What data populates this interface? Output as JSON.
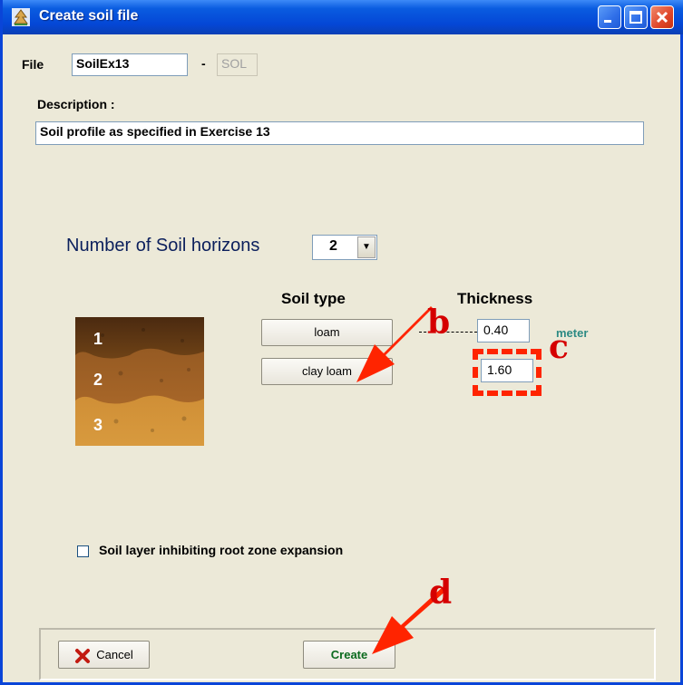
{
  "window": {
    "title": "Create soil file",
    "app_icon": "aquacrop-app-icon"
  },
  "file": {
    "label": "File",
    "name_value": "SoilEx13",
    "separator": "-",
    "extension": "SOL"
  },
  "description": {
    "label": "Description :",
    "value": "Soil profile as specified in Exercise 13"
  },
  "horizons": {
    "label": "Number of Soil horizons",
    "selected": "2"
  },
  "columns": {
    "soil_type": "Soil type",
    "thickness": "Thickness"
  },
  "layers": [
    {
      "soil_type": "loam",
      "thickness": "0.40"
    },
    {
      "soil_type": "clay loam",
      "thickness": "1.60"
    }
  ],
  "thickness_unit": "meter",
  "soil_image_labels": [
    "1",
    "2",
    "3"
  ],
  "checkbox": {
    "label": "Soil layer inhibiting root zone expansion",
    "checked": false
  },
  "buttons": {
    "cancel": "Cancel",
    "create": "Create"
  },
  "annotations": {
    "b": "b",
    "c": "c",
    "d": "d"
  },
  "colors": {
    "titlebar": "#0a5ce0",
    "window_bg": "#ece9d8",
    "annotation": "#d50000",
    "arrow": "#ff2400",
    "create_text": "#0b6a1e"
  }
}
